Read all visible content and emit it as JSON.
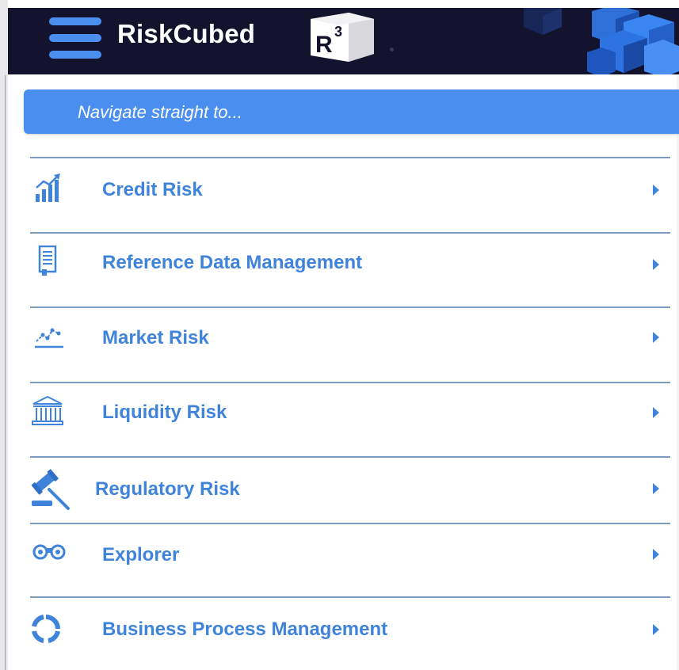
{
  "app": {
    "brand": "RiskCubed",
    "logo_letter": "R",
    "logo_exponent": "3"
  },
  "search": {
    "placeholder": "Navigate straight to..."
  },
  "menu": {
    "items": [
      {
        "label": "Credit Risk",
        "icon": "bar-chart-growth-icon"
      },
      {
        "label": "Reference Data Management",
        "icon": "document-icon"
      },
      {
        "label": "Market Risk",
        "icon": "line-chart-dots-icon"
      },
      {
        "label": "Liquidity Risk",
        "icon": "bank-building-icon"
      },
      {
        "label": "Regulatory Risk",
        "icon": "gavel-icon"
      },
      {
        "label": "Explorer",
        "icon": "binoculars-icon"
      },
      {
        "label": "Business Process Management",
        "icon": "circular-process-icon"
      }
    ]
  },
  "colors": {
    "header_bg": "#13132e",
    "accent": "#4a8ff0",
    "menu_text": "#3f83db",
    "divider": "#7d9bbf"
  }
}
